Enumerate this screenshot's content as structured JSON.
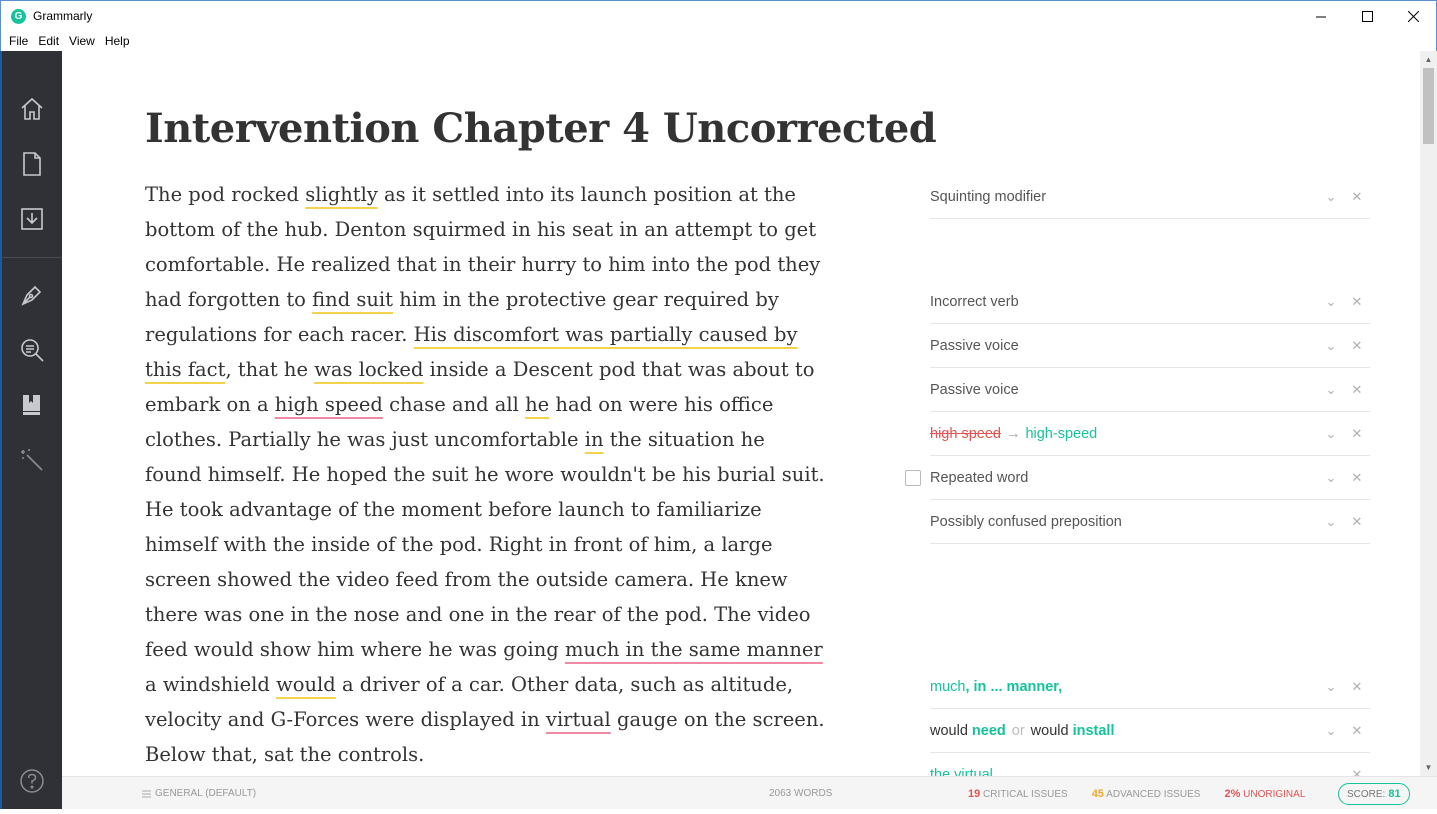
{
  "window": {
    "title": "Grammarly",
    "logo_letter": "G"
  },
  "menu": [
    "File",
    "Edit",
    "View",
    "Help"
  ],
  "sidebar_icons": [
    "home-icon",
    "document-icon",
    "download-icon",
    "pen-icon",
    "search-document-icon",
    "book-icon",
    "magic-wand-icon",
    "help-icon"
  ],
  "document": {
    "title": "Intervention Chapter 4 Uncorrected",
    "p1": [
      {
        "t": "The pod rocked "
      },
      {
        "t": "slightly",
        "u": "y"
      },
      {
        "t": " as it settled into its launch position at the bottom of the hub. Denton squirmed in his seat in an attempt to get comfortable. He realized that in their hurry to him into the pod they had forgotten to "
      },
      {
        "t": "find suit",
        "u": "y"
      },
      {
        "t": " him in the protective gear required by regulations for each racer. "
      },
      {
        "t": "His discomfort was partially caused by this fact",
        "u": "y"
      },
      {
        "t": ", that he "
      },
      {
        "t": "was locked",
        "u": "y"
      },
      {
        "t": " inside a Descent pod that was about to embark on a "
      },
      {
        "t": "high speed",
        "u": "r"
      },
      {
        "t": " chase and all "
      },
      {
        "t": "he",
        "u": "y"
      },
      {
        "t": " had on were his office clothes. Partially he was just uncomfortable "
      },
      {
        "t": "in",
        "u": "y"
      },
      {
        "t": " the situation he found himself. He hoped the suit he wore wouldn't be his burial suit."
      }
    ],
    "p2": [
      {
        "t": "He took advantage of the moment before launch to familiarize himself with the inside of the pod. Right in front of him, a large screen showed the video feed from the outside camera. He knew there was one in the nose and one in the rear of the pod. The video feed would show him where he was going "
      },
      {
        "t": "much in the same manner",
        "u": "r"
      },
      {
        "t": " a windshield "
      },
      {
        "t": "would",
        "u": "y"
      },
      {
        "t": " a driver of a car. Other data, such as altitude, velocity and G-Forces were displayed in "
      },
      {
        "t": "virtual",
        "u": "r"
      },
      {
        "t": " gauge on the screen. Below that, sat the controls."
      }
    ]
  },
  "suggestions": {
    "s1": "Squinting modifier",
    "s2": "Incorrect verb",
    "s3": "Passive voice",
    "s4": "Passive voice",
    "s5_old": "high speed",
    "s5_arrow": "→",
    "s5_new": "high-speed",
    "s6": "Repeated word",
    "s7": "Possibly confused preposition",
    "s8_a": "much",
    "s8_b": ", in ... manner,",
    "s9_a": "would ",
    "s9_b": "need",
    "s9_or": "or",
    "s9_c": "would ",
    "s9_d": "install",
    "s10": "the virtual"
  },
  "status": {
    "goals": "GENERAL (DEFAULT)",
    "words": "2063 WORDS",
    "critical_count": "19",
    "critical_label": "CRITICAL ISSUES",
    "advanced_count": "45",
    "advanced_label": "ADVANCED ISSUES",
    "unoriginal_pct": "2%",
    "unoriginal_label": "UNORIGINAL",
    "score_label": "SCORE:",
    "score_value": "81"
  },
  "colors": {
    "accent": "#15c39a",
    "critical": "#e35454",
    "advanced": "#f0a72a",
    "sidebar": "#2f3136"
  }
}
